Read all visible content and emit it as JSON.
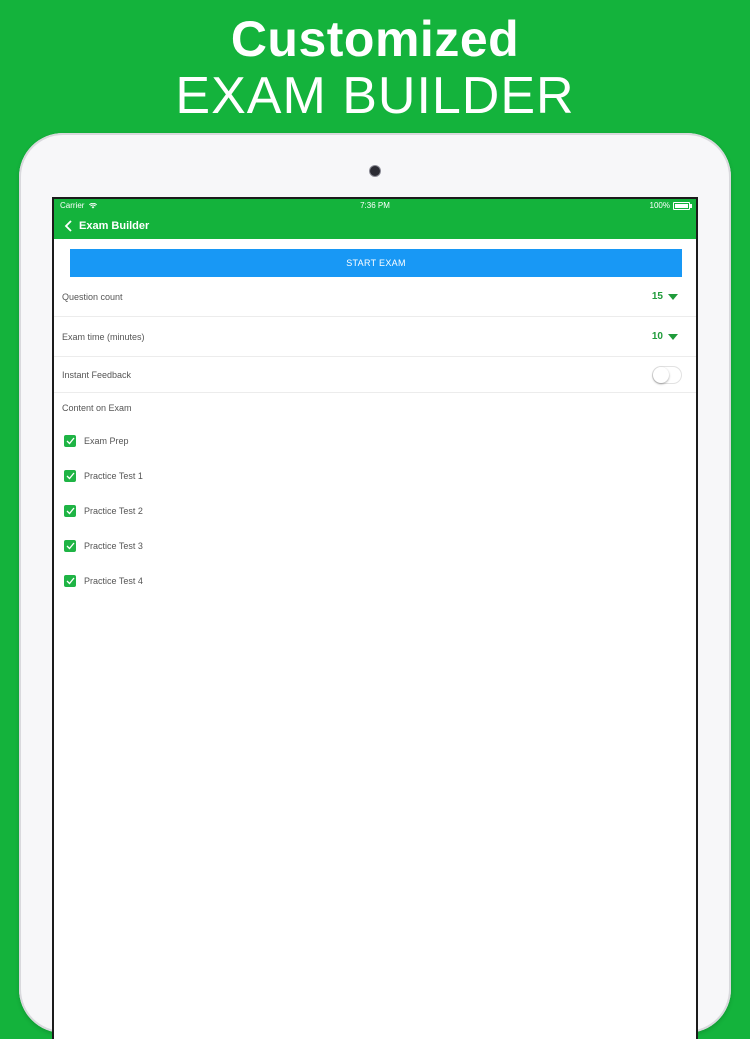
{
  "promo": {
    "line1": "Customized",
    "line2": "EXAM BUILDER"
  },
  "status_bar": {
    "carrier": "Carrier",
    "time": "7:36 PM",
    "battery": "100%"
  },
  "nav": {
    "title": "Exam Builder",
    "back_icon": "chevron-left-icon"
  },
  "actions": {
    "start_exam_label": "START EXAM"
  },
  "settings": {
    "question_count": {
      "label": "Question count",
      "value": "15"
    },
    "exam_time": {
      "label": "Exam time (minutes)",
      "value": "10"
    },
    "instant_feedback": {
      "label": "Instant Feedback",
      "enabled": false
    }
  },
  "content": {
    "heading": "Content on Exam",
    "items": [
      {
        "label": "Exam Prep",
        "checked": true
      },
      {
        "label": "Practice Test 1",
        "checked": true
      },
      {
        "label": "Practice Test 2",
        "checked": true
      },
      {
        "label": "Practice Test 3",
        "checked": true
      },
      {
        "label": "Practice Test 4",
        "checked": true
      }
    ]
  },
  "colors": {
    "brand_green": "#14b33c",
    "button_blue": "#1898f5",
    "value_green": "#1f9b3a",
    "checkbox_green": "#1fb445"
  }
}
